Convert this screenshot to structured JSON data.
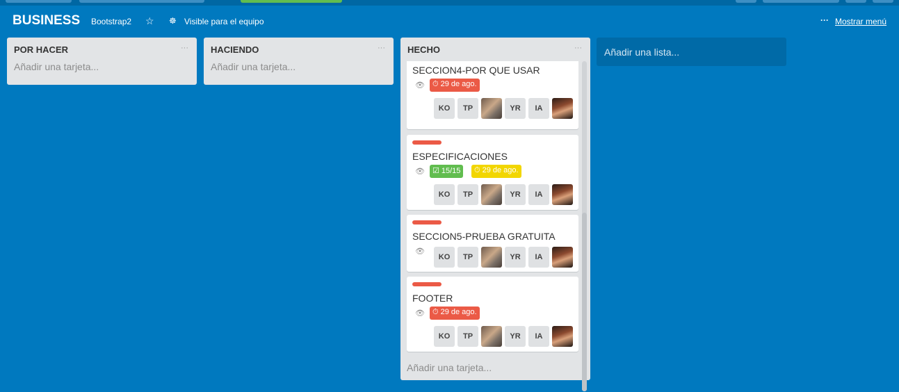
{
  "header": {
    "title": "BUSINESS",
    "team": "Bootstrap2",
    "visibility": "Visible para el equipo",
    "menu_label": "Mostrar menú"
  },
  "lists": [
    {
      "title": "POR HACER",
      "add_card": "Añadir una tarjeta..."
    },
    {
      "title": "HACIENDO",
      "add_card": "Añadir una tarjeta..."
    },
    {
      "title": "HECHO",
      "add_card": "Añadir una tarjeta...",
      "cards": [
        {
          "title": "SECCION4-POR QUE USAR",
          "due": "29 de ago.",
          "due_status": "overdue",
          "members": [
            "KO",
            "TP",
            "photo",
            "YR",
            "IA",
            "photo2"
          ]
        },
        {
          "title": "ESPECIFICACIONES",
          "checklist": "15/15",
          "due": "29 de ago.",
          "due_status": "due-soon",
          "members": [
            "KO",
            "TP",
            "photo",
            "YR",
            "IA",
            "photo2"
          ]
        },
        {
          "title": "SECCION5-PRUEBA GRATUITA",
          "members": [
            "KO",
            "TP",
            "photo",
            "YR",
            "IA",
            "photo2"
          ]
        },
        {
          "title": "FOOTER",
          "due": "29 de ago.",
          "due_status": "overdue",
          "members": [
            "KO",
            "TP",
            "photo",
            "YR",
            "IA",
            "photo2"
          ]
        }
      ]
    }
  ],
  "add_list": "Añadir una lista...",
  "colors": {
    "board_bg": "#0079bf",
    "label_red": "#eb5a46",
    "badge_green": "#61bd4f",
    "badge_yellow": "#f2d600"
  },
  "icons": {
    "star": "star-icon",
    "visibility": "team-icon",
    "menu": "ellipsis-icon",
    "watch": "eye-icon",
    "due": "clock-icon",
    "checklist": "checkbox-icon"
  }
}
